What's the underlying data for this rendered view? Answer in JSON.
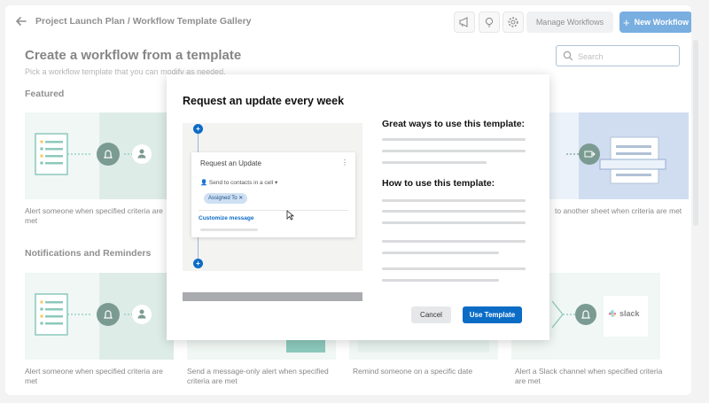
{
  "header": {
    "breadcrumb": "Project Launch Plan / Workflow Template Gallery",
    "manage_workflows": "Manage Workflows",
    "new_workflow": "New Workflow"
  },
  "page": {
    "title": "Create a workflow from a template",
    "subtitle": "Pick a workflow template that you can modify as needed."
  },
  "search": {
    "placeholder": "Search",
    "value": ""
  },
  "sections": {
    "featured": "Featured",
    "notifications": "Notifications and Reminders"
  },
  "cards": {
    "featured_1": "Alert someone when specified criteria are met",
    "featured_2": "to another sheet when criteria are met",
    "notif_1": "Alert someone when specified criteria are met",
    "notif_2": "Send a message-only alert when specified criteria are met",
    "notif_3": "Remind someone on a specific date",
    "notif_4": "Alert a Slack channel when specified criteria are met"
  },
  "slack_label": "slack",
  "modal": {
    "title": "Request an update every week",
    "preview": {
      "card_title": "Request an Update",
      "send_to": "Send to contacts in a cell",
      "chip": "Assigned To",
      "customize": "Customize message"
    },
    "ways_heading": "Great ways to use this template:",
    "how_heading": "How to use this template:",
    "cancel": "Cancel",
    "use_template": "Use Template"
  },
  "colors": {
    "accent": "#0b6cc6",
    "teal_light": "#e4f0ec",
    "teal_mid": "#c3ddd3",
    "dark_green": "#0f4a3a",
    "blue_light": "#a9c2e6"
  },
  "icons": {
    "back": "arrow-left-icon",
    "announce": "megaphone-icon",
    "idea": "lightbulb-icon",
    "settings": "gear-icon",
    "search": "search-icon",
    "bell": "bell-icon",
    "user": "user-icon"
  }
}
